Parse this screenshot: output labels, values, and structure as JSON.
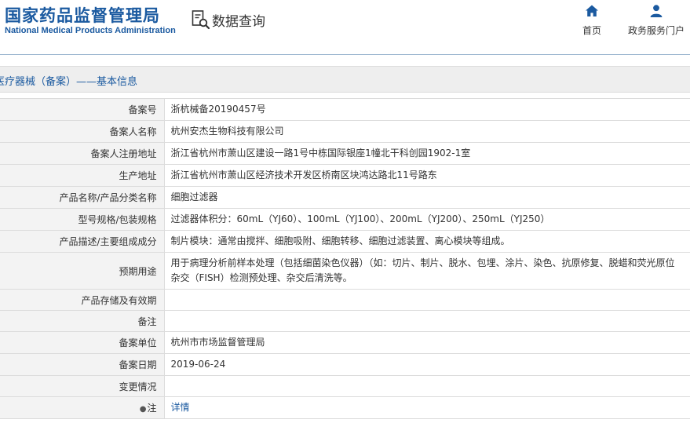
{
  "header": {
    "agency_cn": "国家药品监督管理局",
    "agency_en": "National Medical Products Administration",
    "data_query": "数据查询",
    "nav": [
      {
        "label": "首页",
        "icon": "home-icon"
      },
      {
        "label": "政务服务门户",
        "icon": "user-icon"
      }
    ]
  },
  "section": {
    "title": "医疗器械（备案）——基本信息"
  },
  "record": {
    "rows": [
      {
        "label": "备案号",
        "value": "浙杭械备20190457号"
      },
      {
        "label": "备案人名称",
        "value": "杭州安杰生物科技有限公司"
      },
      {
        "label": "备案人注册地址",
        "value": "浙江省杭州市萧山区建设一路1号中栋国际银座1幢北干科创园1902-1室"
      },
      {
        "label": "生产地址",
        "value": "浙江省杭州市萧山区经济技术开发区桥南区块鸿达路北11号路东"
      },
      {
        "label": "产品名称/产品分类名称",
        "value": "细胞过滤器"
      },
      {
        "label": "型号规格/包装规格",
        "value": "过滤器体积分：60mL（YJ60）、100mL（YJ100）、200mL（YJ200）、250mL（YJ250）"
      },
      {
        "label": "产品描述/主要组成成分",
        "value": "制片模块：通常由搅拌、细胞吸附、细胞转移、细胞过滤装置、离心模块等组成。"
      },
      {
        "label": "预期用途",
        "value": "用于病理分析前样本处理（包括细菌染色仪器）（如：切片、制片、脱水、包埋、涂片、染色、抗原修复、脱蜡和荧光原位杂交（FISH）检测预处理、杂交后清洗等。"
      },
      {
        "label": "产品存储及有效期",
        "value": ""
      },
      {
        "label": "备注",
        "value": ""
      },
      {
        "label": "备案单位",
        "value": "杭州市市场监督管理局"
      },
      {
        "label": "备案日期",
        "value": "2019-06-24"
      },
      {
        "label": "变更情况",
        "value": ""
      }
    ],
    "note_row": {
      "label": "注",
      "link": "详情"
    }
  }
}
